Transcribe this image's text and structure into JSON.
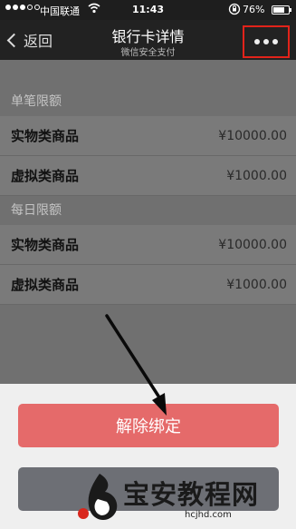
{
  "status_bar": {
    "carrier": "中国联通",
    "time": "11:43",
    "battery": "76%",
    "battery_level": 0.76
  },
  "nav": {
    "back_label": "返回",
    "title": "银行卡详情",
    "subtitle": "微信安全支付"
  },
  "sections": [
    {
      "header": "单笔限额",
      "rows": [
        {
          "label": "实物类商品",
          "value": "¥10000.00"
        },
        {
          "label": "虚拟类商品",
          "value": "¥1000.00"
        }
      ]
    },
    {
      "header": "每日限额",
      "rows": [
        {
          "label": "实物类商品",
          "value": "¥10000.00"
        },
        {
          "label": "虚拟类商品",
          "value": "¥1000.00"
        }
      ]
    }
  ],
  "action_sheet": {
    "unbind_label": "解除绑定"
  },
  "watermark": {
    "text": "宝安教程网",
    "url": "hcjhd.com"
  },
  "colors": {
    "unbind_button": "#e56a6a",
    "highlight_box": "#e2231a"
  }
}
